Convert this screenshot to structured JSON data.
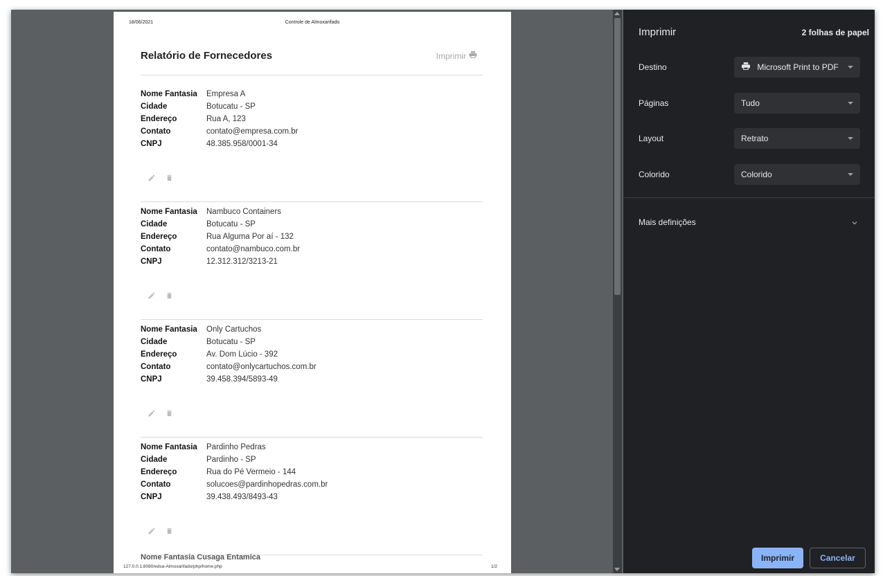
{
  "paper": {
    "header_date": "18/06/2021",
    "header_title": "Controle de Almoxarifado",
    "report_title": "Relatório de Fornecedores",
    "print_link": "Imprimir",
    "footer_url": "127.0.0.1:8080/edsa-Almoxarifado/php/home.php",
    "footer_page": "1/2",
    "cut_text": "Nome Fantasia    Cusaga Entamica"
  },
  "labels": {
    "nome_fantasia": "Nome Fantasia",
    "cidade": "Cidade",
    "endereco": "Endereço",
    "contato": "Contato",
    "cnpj": "CNPJ"
  },
  "records": [
    {
      "nome": "Empresa A",
      "cidade": "Botucatu - SP",
      "endereco": "Rua A, 123",
      "contato": "contato@empresa.com.br",
      "cnpj": "48.385.958/0001-34"
    },
    {
      "nome": "Nambuco Containers",
      "cidade": "Botucatu - SP",
      "endereco": "Rua Alguma Por aí - 132",
      "contato": "contato@nambuco.com.br",
      "cnpj": "12.312.312/3213-21"
    },
    {
      "nome": "Only Cartuchos",
      "cidade": "Botucatu - SP",
      "endereco": "Av. Dom Lúcio - 392",
      "contato": "contato@onlycartuchos.com.br",
      "cnpj": "39.458.394/5893-49"
    },
    {
      "nome": "Pardinho Pedras",
      "cidade": "Pardinho - SP",
      "endereco": "Rua do Pé Vermeio - 144",
      "contato": "solucoes@pardinhopedras.com.br",
      "cnpj": "39.438.493/8493-43"
    }
  ],
  "panel": {
    "title": "Imprimir",
    "sheet_count": "2 folhas de papel",
    "destino_label": "Destino",
    "destino_value": "Microsoft Print to PDF",
    "paginas_label": "Páginas",
    "paginas_value": "Tudo",
    "layout_label": "Layout",
    "layout_value": "Retrato",
    "colorido_label": "Colorido",
    "colorido_value": "Colorido",
    "mais_label": "Mais definições",
    "print_button": "Imprimir",
    "cancel_button": "Cancelar"
  },
  "icons": {
    "printer": "printer-icon",
    "edit": "pencil-icon",
    "delete": "trash-icon",
    "chevron": "chevron-down-icon"
  },
  "colors": {
    "accent": "#8ab4f8",
    "panel_bg": "#202124",
    "preview_bg": "#5b5f62"
  }
}
